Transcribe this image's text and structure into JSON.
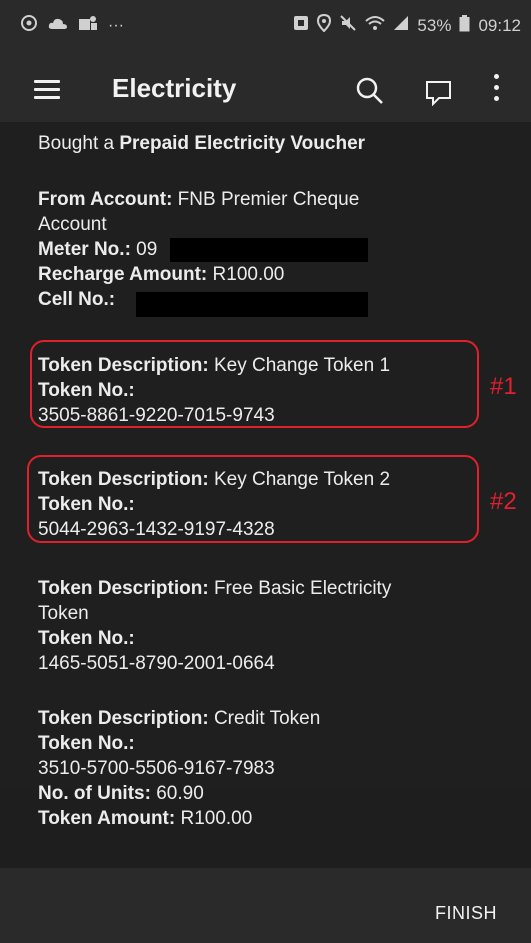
{
  "status_bar": {
    "left_icons": [
      "whatsapp-icon",
      "cloud-icon",
      "teams-icon"
    ],
    "more_indicator": "···",
    "right_icons": [
      "nfc-icon",
      "location-icon",
      "mute-icon",
      "wifi-icon",
      "signal-icon"
    ],
    "battery": "53%",
    "time": "09:12"
  },
  "app_bar": {
    "title": "Electricity",
    "icons": [
      "menu-icon",
      "search-icon",
      "chat-icon",
      "more-vertical-icon"
    ]
  },
  "content": {
    "intro_prefix": "Bought a ",
    "intro_bold": "Prepaid Electricity Voucher",
    "from_account_label": "From Account:",
    "from_account_value_1": " FNB Premier Cheque",
    "from_account_value_2": "Account",
    "meter_label": "Meter No.:",
    "meter_value": " 09",
    "recharge_label": "Recharge Amount:",
    "recharge_value": " R100.00",
    "cell_label": "Cell No.:",
    "tokens": [
      {
        "desc_label": "Token Description:",
        "desc_value": " Key Change Token 1",
        "no_label": "Token No.:",
        "number": "3505-8861-9220-7015-9743",
        "annotation": "#1"
      },
      {
        "desc_label": "Token Description:",
        "desc_value": " Key Change Token 2",
        "no_label": "Token No.:",
        "number": "5044-2963-1432-9197-4328",
        "annotation": "#2"
      },
      {
        "desc_label": "Token Description:",
        "desc_value_1": " Free Basic Electricity",
        "desc_value_2": "Token",
        "no_label": "Token No.:",
        "number": "1465-5051-8790-2001-0664"
      },
      {
        "desc_label": "Token Description:",
        "desc_value": " Credit Token",
        "no_label": "Token No.:",
        "number": "3510-5700-5506-9167-7983",
        "units_label": "No. of Units:",
        "units_value": " 60.90",
        "amount_label": "Token Amount:",
        "amount_value": " R100.00"
      }
    ]
  },
  "footer": {
    "finish_label": "FINISH"
  },
  "colors": {
    "background": "#1f1f1f",
    "bar": "#2a2a2a",
    "annotation_red": "#e0202a",
    "text": "#ececec"
  }
}
